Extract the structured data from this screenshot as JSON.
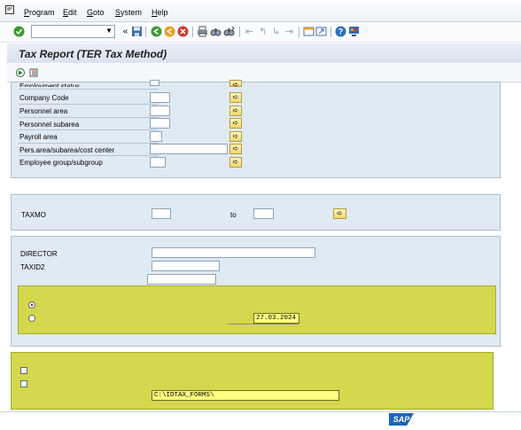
{
  "menu": {
    "items": [
      {
        "label": "Program",
        "u": "P",
        "rest": "rogram"
      },
      {
        "label": "Edit",
        "u": "E",
        "rest": "dit"
      },
      {
        "label": "Goto",
        "u": "G",
        "rest": "oto"
      },
      {
        "label": "System",
        "u": "S",
        "rest": "ystem"
      },
      {
        "label": "Help",
        "u": "H",
        "rest": "elp"
      }
    ]
  },
  "toolbar": {
    "command_field_value": "",
    "icons": [
      "enter-icon",
      "command-dropdown-icon",
      "rewind-icon",
      "save-icon",
      "back-icon",
      "exit-icon",
      "cancel-icon",
      "print-icon",
      "find-icon",
      "find-next-icon",
      "first-page-icon",
      "prev-page-icon",
      "next-page-icon",
      "last-page-icon",
      "new-session-icon",
      "shortcut-icon",
      "help-icon",
      "customize-layout-icon"
    ]
  },
  "title": "Tax Report (TER Tax Method)",
  "selection": {
    "fields": [
      {
        "label": "Employment status"
      },
      {
        "label": "Company Code"
      },
      {
        "label": "Personnel area"
      },
      {
        "label": "Personnel subarea"
      },
      {
        "label": "Payroll area"
      },
      {
        "label": "Pers.area/subarea/cost center"
      },
      {
        "label": "Employee group/subgroup"
      }
    ]
  },
  "taxmo": {
    "label": "TAXMO",
    "to_label": "to",
    "from_value": "",
    "to_value": ""
  },
  "director": {
    "label": "DIRECTOR",
    "value": ""
  },
  "taxid2": {
    "label": "TAXID2",
    "value": ""
  },
  "date": {
    "value": "27.03.2024"
  },
  "path": {
    "value": "C:\\IDTAX_FORMS\\"
  },
  "colors": {
    "panel": "#dfeaf3",
    "highlight": "#d4d84e",
    "input_yellow": "#ffff80"
  }
}
